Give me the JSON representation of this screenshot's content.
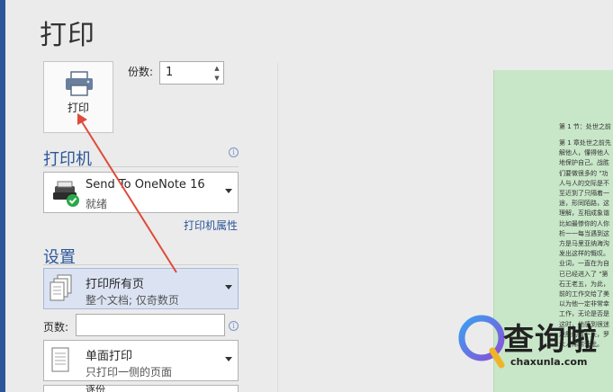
{
  "page": {
    "title": "打印"
  },
  "print_button": {
    "label": "打印",
    "icon": "printer-icon"
  },
  "copies": {
    "label": "份数:",
    "value": "1"
  },
  "printer": {
    "heading": "打印机",
    "name": "Send To OneNote 16",
    "status": "就绪",
    "properties_link": "打印机属性",
    "icon": "printer-ready-icon"
  },
  "settings": {
    "heading": "设置",
    "page_range": {
      "title": "打印所有页",
      "subtitle": "整个文档; 仅奇数页"
    },
    "pages_label": "页数:",
    "pages_value": "",
    "sides": {
      "title": "单面打印",
      "subtitle": "只打印一侧的页面"
    },
    "collate": {
      "title": "逐份"
    }
  },
  "preview": {
    "lines": [
      "第 1 节：处世之前",
      "",
      "第 1 章处世之前先",
      "解他人，懂得他人",
      "地保护自己。战胜",
      "们要做很多的 \"功",
      "人与人的交际是不",
      "至近到了只隔着一",
      "途，形同陌路，这",
      "理解，互相成象谐",
      "比如最惨你的人你",
      "析一一每当遇到这",
      "方是马里亚纳海沟",
      "发出这样的慨叹。",
      "业词，一直在为自",
      "已已经进入了 \"第",
      "石王老五，为此，",
      "前的工作交给了美",
      "以为他一定非常幸",
      "工作，无论是否是",
      "这时，他感到很迷",
      "泼殷的有一天，罗",
      "大人稀稀营批。"
    ]
  },
  "watermark": {
    "brand": "查询啦",
    "url": "chaxunla.com"
  },
  "colors": {
    "accent": "#2b579a",
    "selected": "#dbe3f3",
    "preview_bg": "#c8e6c8",
    "arrow": "#e04a3a"
  }
}
